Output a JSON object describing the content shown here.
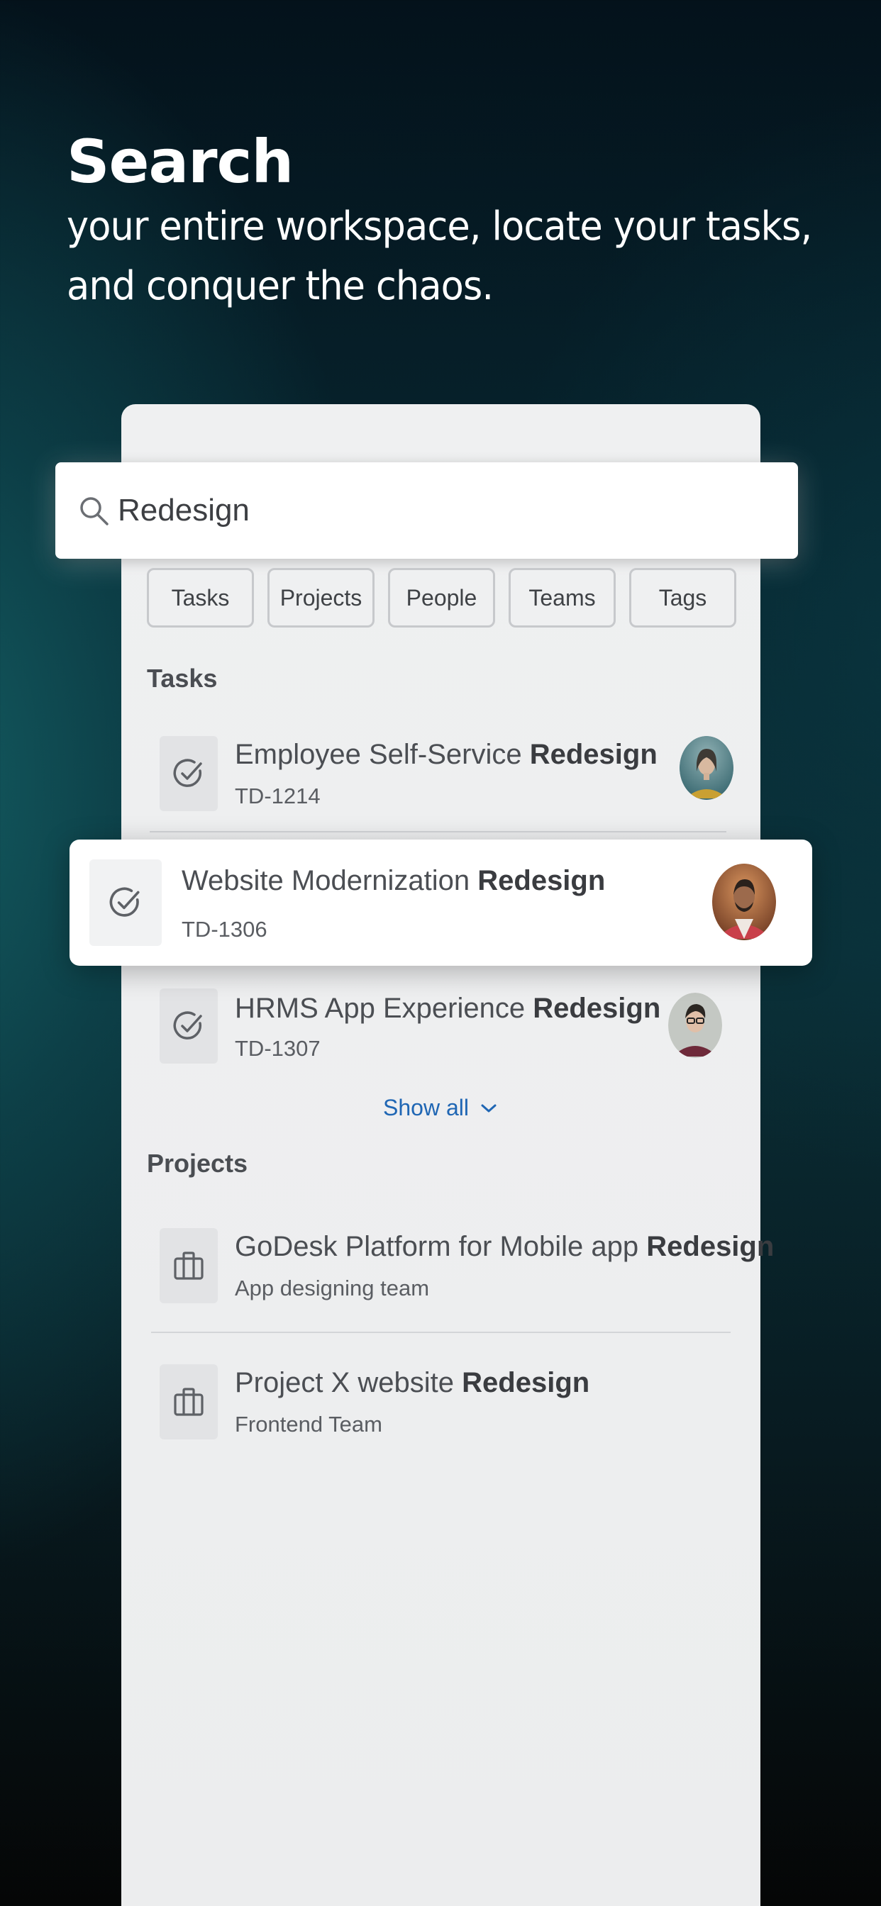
{
  "headline": {
    "title": "Search",
    "subtitle_line1": "your entire workspace, locate your tasks,",
    "subtitle_line2": "and conquer the chaos."
  },
  "search": {
    "query": "Redesign",
    "icon": "search-icon"
  },
  "filters": [
    "Tasks",
    "Projects",
    "People",
    "Teams",
    "Tags"
  ],
  "tasks_section": {
    "label": "Tasks",
    "items": [
      {
        "title": "Employee Self-Service",
        "highlight": "Redesign",
        "id": "TD-1214",
        "icon": "check-circle-icon"
      },
      {
        "title": "Website Modernization ",
        "highlight": "Redesign",
        "id": "TD-1306",
        "icon": "check-circle-icon"
      },
      {
        "title": "HRMS App Experience",
        "highlight": "Redesign",
        "id": "TD-1307",
        "icon": "check-circle-icon"
      }
    ],
    "show_all": "Show all"
  },
  "projects_section": {
    "label": "Projects",
    "items": [
      {
        "title": "GoDesk Platform for Mobile app",
        "highlight": "Redesign",
        "team": "App designing team",
        "icon": "briefcase-icon"
      },
      {
        "title": "Project X website",
        "highlight": "Redesign",
        "team": "Frontend Team",
        "icon": "briefcase-icon"
      }
    ]
  },
  "colors": {
    "accent_link": "#1f66b4",
    "panel_bg": "#eff0f1",
    "text_primary": "#3a3c40"
  }
}
